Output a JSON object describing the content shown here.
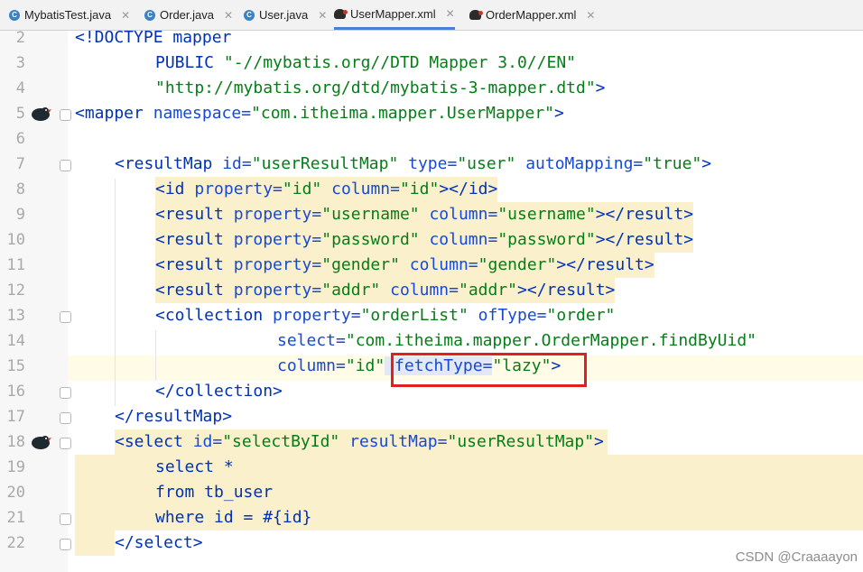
{
  "tabs": [
    {
      "label": "MybatisTest.java",
      "type": "java",
      "active": false
    },
    {
      "label": "Order.java",
      "type": "java",
      "active": false
    },
    {
      "label": "User.java",
      "type": "java",
      "active": false
    },
    {
      "label": "UserMapper.xml",
      "type": "xml",
      "active": true
    },
    {
      "label": "OrderMapper.xml",
      "type": "xml",
      "active": false
    }
  ],
  "line_numbers": [
    "2",
    "3",
    "4",
    "5",
    "6",
    "7",
    "8",
    "9",
    "10",
    "11",
    "12",
    "13",
    "14",
    "15",
    "16",
    "17",
    "18",
    "19",
    "20",
    "21",
    "22"
  ],
  "code": {
    "l2": [
      "<!DOCTYPE mapper"
    ],
    "l3": [
      "PUBLIC ",
      "\"-//mybatis.org//DTD Mapper 3.0//EN\""
    ],
    "l4": [
      "\"http://mybatis.org/dtd/mybatis-3-mapper.dtd\"",
      ">"
    ],
    "l5": [
      "<mapper ",
      "namespace=",
      "\"com.itheima.mapper.UserMapper\"",
      ">"
    ],
    "l7": [
      "<resultMap ",
      "id=",
      "\"userResultMap\"",
      " type=",
      "\"user\"",
      " autoMapping=",
      "\"true\"",
      ">"
    ],
    "l8": [
      "<id ",
      "property=",
      "\"id\"",
      " column=",
      "\"id\"",
      "></id>"
    ],
    "l9": [
      "<result ",
      "property=",
      "\"username\"",
      " column=",
      "\"username\"",
      "></result>"
    ],
    "l10": [
      "<result ",
      "property=",
      "\"password\"",
      " column=",
      "\"password\"",
      "></result>"
    ],
    "l11": [
      "<result ",
      "property=",
      "\"gender\"",
      " column=",
      "\"gender\"",
      "></result>"
    ],
    "l12": [
      "<result ",
      "property=",
      "\"addr\"",
      " column=",
      "\"addr\"",
      "></result>"
    ],
    "l13": [
      "<collection ",
      "property=",
      "\"orderList\"",
      " ofType=",
      "\"order\""
    ],
    "l14": [
      "select=",
      "\"com.itheima.mapper.OrderMapper.findByUid\""
    ],
    "l15": [
      "column=",
      "\"id\"",
      " fetchType=",
      "\"lazy\"",
      ">"
    ],
    "l16": [
      "</collection>"
    ],
    "l17": [
      "</resultMap>"
    ],
    "l18": [
      "<select ",
      "id=",
      "\"selectById\"",
      " resultMap=",
      "\"userResultMap\"",
      ">"
    ],
    "l19": [
      "select *"
    ],
    "l20": [
      "from tb_user"
    ],
    "l21": [
      "where id = #{id}"
    ],
    "l22": [
      "</select>"
    ]
  },
  "watermark": "CSDN @Craaaayon",
  "colors": {
    "tag": "#0033b3",
    "value": "#067d17",
    "highlight": "#fbf0cc",
    "box": "#e02020"
  }
}
